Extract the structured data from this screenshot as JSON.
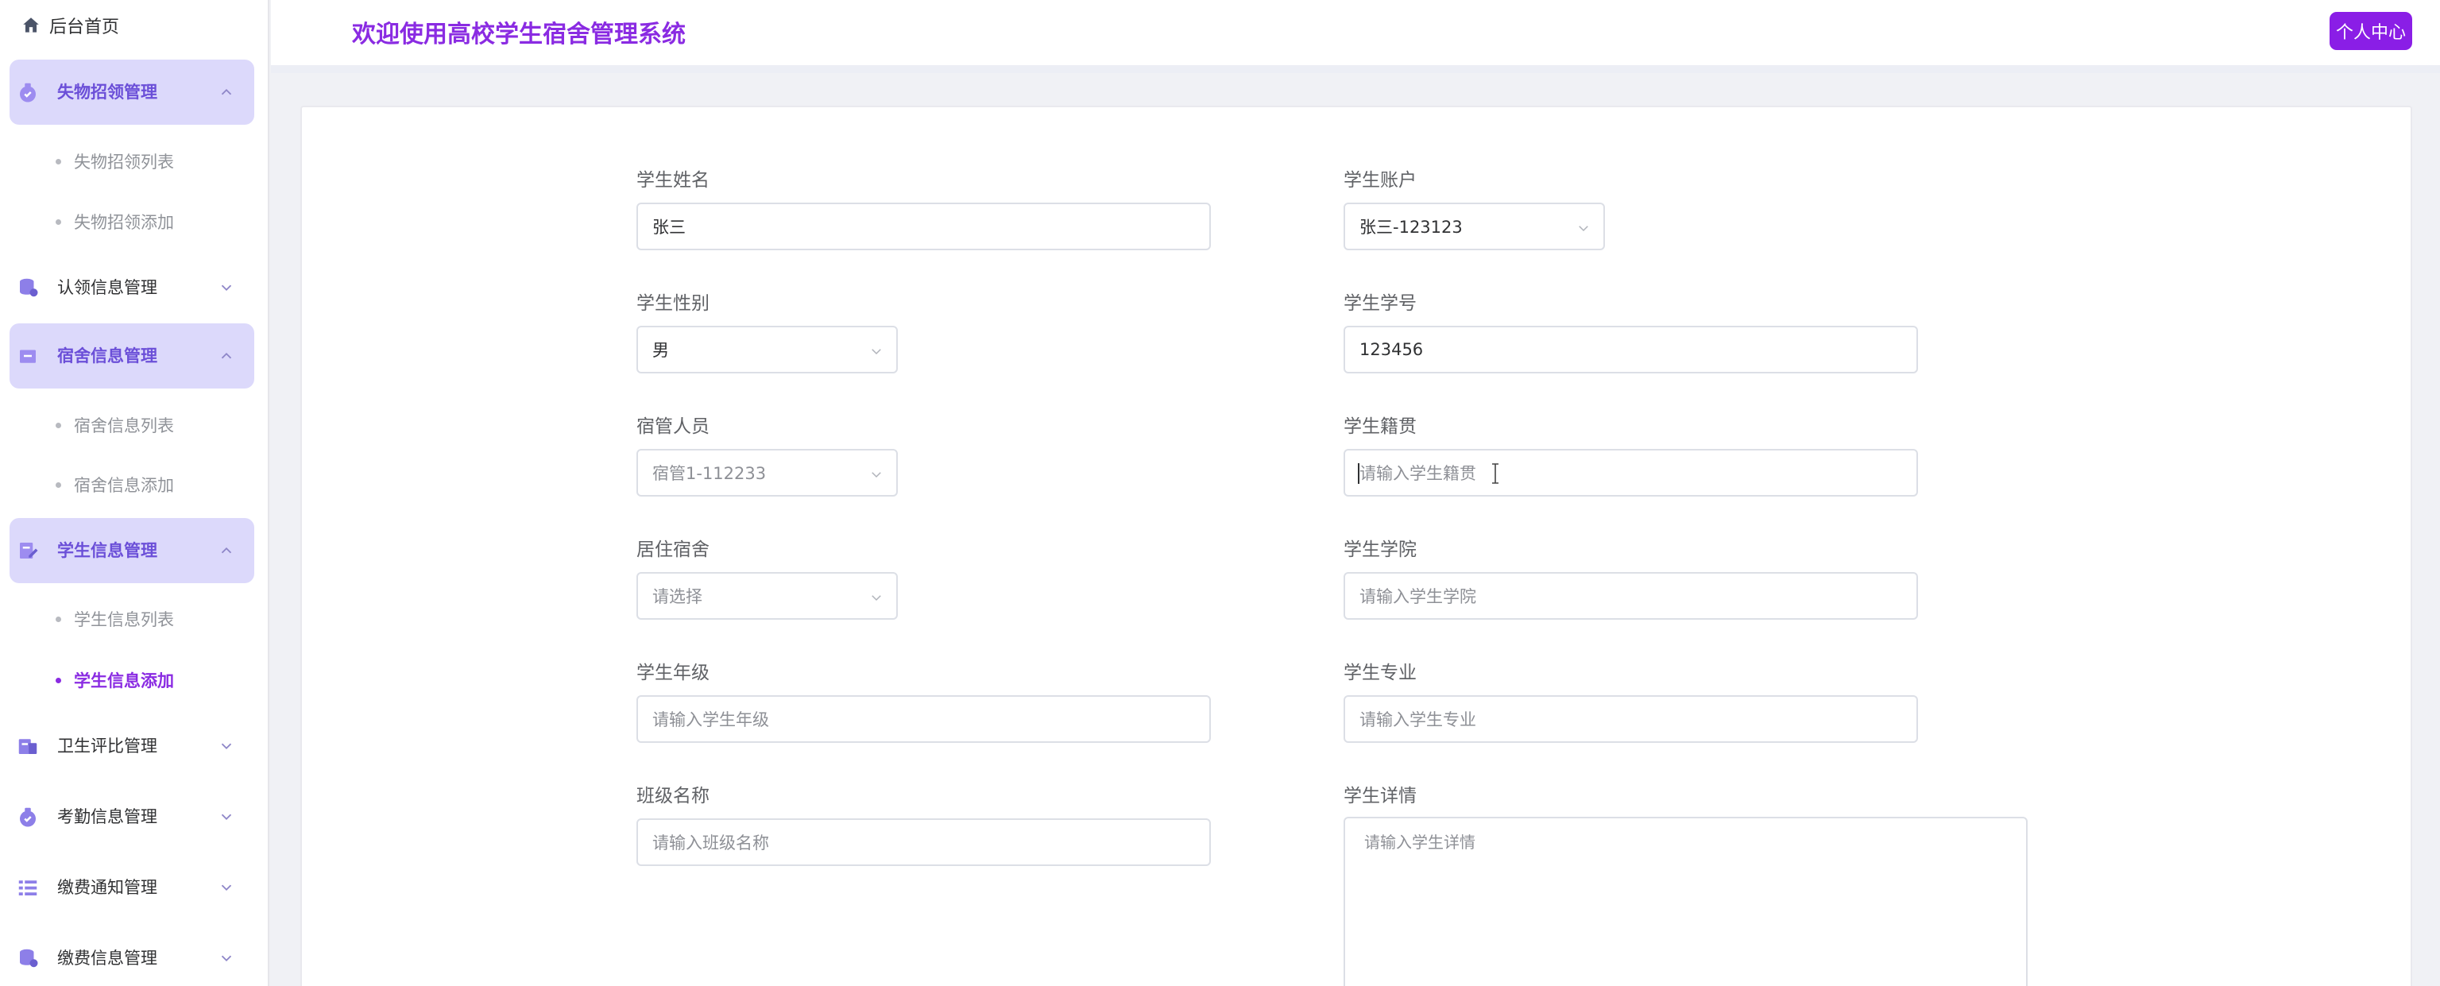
{
  "header": {
    "title": "欢迎使用高校学生宿舍管理系统",
    "profile_button": "个人中心"
  },
  "sidebar": {
    "home": "后台首页",
    "groups": [
      {
        "label": "失物招领管理",
        "icon": "bag-icon",
        "expanded": true,
        "items": [
          "失物招领列表",
          "失物招领添加"
        ]
      },
      {
        "label": "认领信息管理",
        "icon": "database-icon",
        "expanded": false
      },
      {
        "label": "宿舍信息管理",
        "icon": "inbox-icon",
        "expanded": true,
        "items": [
          "宿舍信息列表",
          "宿舍信息添加"
        ]
      },
      {
        "label": "学生信息管理",
        "icon": "edit-doc-icon",
        "expanded": true,
        "items": [
          "学生信息列表",
          "学生信息添加"
        ],
        "active_item": "学生信息添加"
      },
      {
        "label": "卫生评比管理",
        "icon": "report-icon",
        "expanded": false
      },
      {
        "label": "考勤信息管理",
        "icon": "bag-icon",
        "expanded": false
      },
      {
        "label": "缴费通知管理",
        "icon": "list-icon",
        "expanded": false
      },
      {
        "label": "缴费信息管理",
        "icon": "database-icon",
        "expanded": false
      }
    ]
  },
  "form": {
    "student_name": {
      "label": "学生姓名",
      "value": "张三"
    },
    "student_account": {
      "label": "学生账户",
      "value": "张三-123123"
    },
    "student_gender": {
      "label": "学生性别",
      "value": "男"
    },
    "student_id": {
      "label": "学生学号",
      "value": "123456"
    },
    "dorm_manager": {
      "label": "宿管人员",
      "value": "宿管1-112233"
    },
    "native_place": {
      "label": "学生籍贯",
      "placeholder": "请输入学生籍贯"
    },
    "dormitory": {
      "label": "居住宿舍",
      "placeholder": "请选择"
    },
    "college": {
      "label": "学生学院",
      "placeholder": "请输入学生学院"
    },
    "grade": {
      "label": "学生年级",
      "placeholder": "请输入学生年级"
    },
    "major": {
      "label": "学生专业",
      "placeholder": "请输入学生专业"
    },
    "class_name": {
      "label": "班级名称",
      "placeholder": "请输入班级名称"
    },
    "details": {
      "label": "学生详情",
      "placeholder": "请输入学生详情"
    }
  },
  "colors": {
    "brand": "#8a2be2",
    "menu_open_bg": "#dcd9fb",
    "menu_open_text": "#6b4fd8",
    "border": "#dcdfe6"
  }
}
